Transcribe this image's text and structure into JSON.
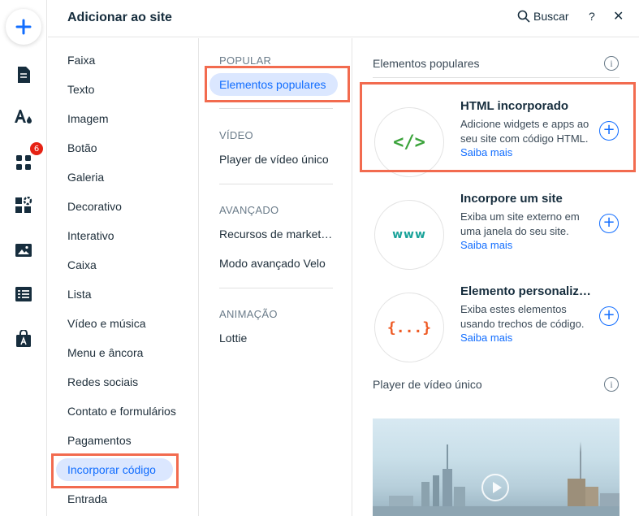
{
  "header": {
    "title": "Adicionar ao site",
    "search_label": "Buscar",
    "help_label": "?",
    "close_label": "✕"
  },
  "rail": {
    "apps_badge": "6",
    "icons": [
      "add-icon",
      "page-icon",
      "theme-icon",
      "apps-icon",
      "business-icon",
      "media-icon",
      "cms-icon",
      "market-icon"
    ]
  },
  "categories": [
    "Faixa",
    "Texto",
    "Imagem",
    "Botão",
    "Galeria",
    "Decorativo",
    "Interativo",
    "Caixa",
    "Lista",
    "Vídeo e música",
    "Menu e âncora",
    "Redes sociais",
    "Contato e formulários",
    "Pagamentos",
    "Incorporar código",
    "Entrada"
  ],
  "active_category": "Incorporar código",
  "subcategories": {
    "popular_label": "POPULAR",
    "popular_item": "Elementos populares",
    "video_label": "VÍDEO",
    "video_item": "Player de vídeo único",
    "advanced_label": "AVANÇADO",
    "advanced_item_1": "Recursos de marketing",
    "advanced_item_2": "Modo avançado Velo",
    "animation_label": "ANIMAÇÃO",
    "animation_item": "Lottie"
  },
  "popular_section": {
    "heading": "Elementos populares",
    "info": "i",
    "items": [
      {
        "name": "HTML incorporado",
        "icon_text": "</>",
        "desc": "Adicione widgets e apps ao seu site com código HTML.",
        "link": "Saiba mais",
        "add": "+"
      },
      {
        "name": "Incorpore um site",
        "icon_text": "www",
        "desc": "Exiba um site externo em uma janela do seu site.",
        "link": "Saiba mais",
        "add": "+"
      },
      {
        "name": "Elemento personalizado",
        "icon_text": "{...}",
        "desc": "Exiba estes elementos usando trechos de código.",
        "link": "Saiba mais",
        "add": "+"
      }
    ]
  },
  "video_section": {
    "heading": "Player de vídeo único",
    "info": "i"
  },
  "colors": {
    "accent": "#116dff",
    "highlight": "#f26b4f",
    "html_icon": "#3ba33b",
    "www_icon": "#1aa39a",
    "custom_icon": "#ee5a24",
    "badge": "#e62214"
  }
}
